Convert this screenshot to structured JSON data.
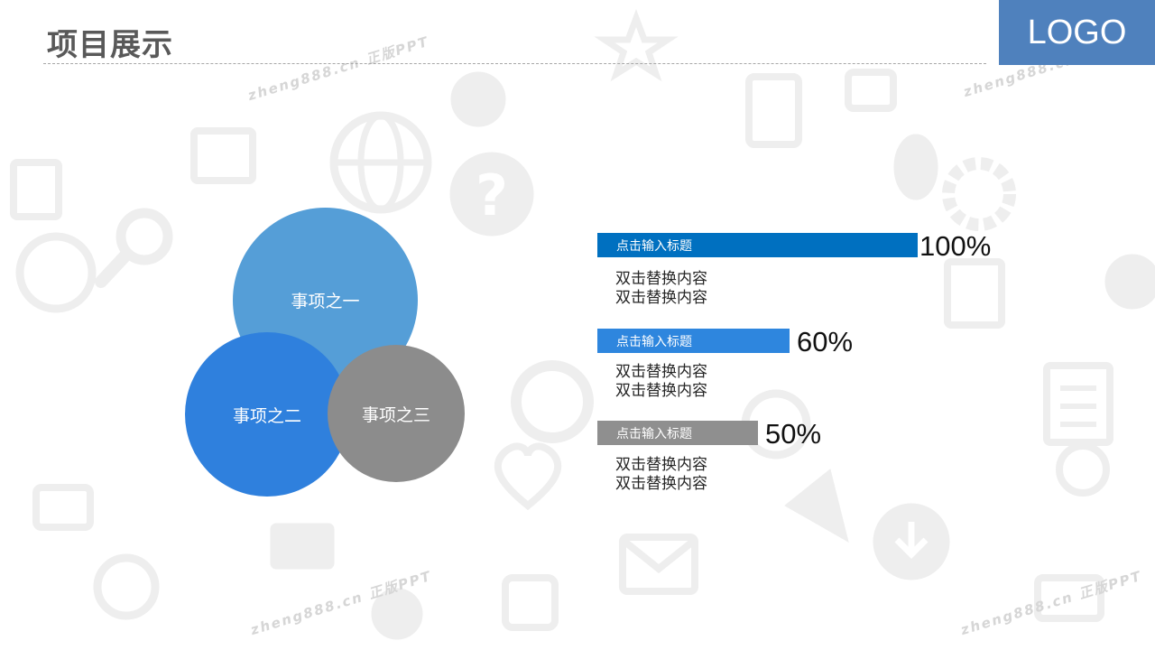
{
  "slide": {
    "title": "项目展示",
    "logo": "LOGO"
  },
  "watermark": "zheng888.cn 正版PPT",
  "circles": [
    {
      "label": "事项之一",
      "color": "#4897d4"
    },
    {
      "label": "事项之二",
      "color": "#2f80dd"
    },
    {
      "label": "事项之三",
      "color": "#8c8c8c"
    }
  ],
  "chart_data": {
    "type": "bar",
    "categories": [
      "点击输入标题",
      "点击输入标题",
      "点击输入标题"
    ],
    "values": [
      100,
      60,
      50
    ],
    "value_labels": [
      "100%",
      "60%",
      "50%"
    ],
    "colors": [
      "#0070c0",
      "#2e86de",
      "#8f8f8f"
    ],
    "orientation": "horizontal",
    "xlim": [
      0,
      100
    ],
    "descriptions": [
      [
        "双击替换内容",
        "双击替换内容"
      ],
      [
        "双击替换内容",
        "双击替换内容"
      ],
      [
        "双击替换内容",
        "双击替换内容"
      ]
    ]
  },
  "background_icons": [
    "globe-icon",
    "question-icon",
    "magnifier-icon",
    "mail-icon",
    "heart-icon",
    "download-icon",
    "smile-icon",
    "star-icon",
    "tablet-icon",
    "gear-icon",
    "penguin-icon",
    "document-icon"
  ]
}
